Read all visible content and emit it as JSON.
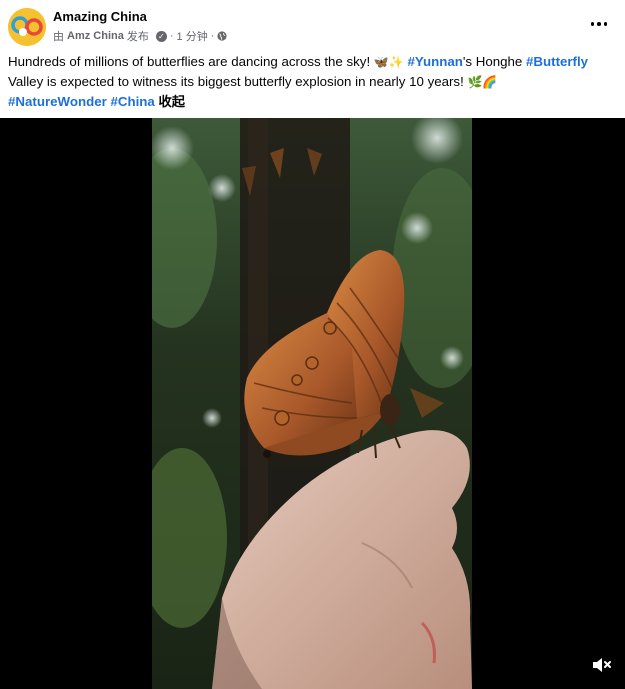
{
  "header": {
    "page_name": "Amazing China",
    "author_prefix": "由",
    "author": "Amz China",
    "published": "发布",
    "separator": "·",
    "time_ago": "1 分钟",
    "separator2": "·",
    "more_icon": "more-horizontal-icon",
    "verified_icon": "verified-badge-icon",
    "audience_icon": "globe-icon"
  },
  "caption": {
    "part1": "Hundreds of millions of butterflies are dancing across the sky! ",
    "emoji1": "🦋✨",
    "space1": " ",
    "tag_yunnan": "#Yunnan",
    "part2": "'s Honghe ",
    "tag_butterfly": "#Butterfly",
    "part3": " Valley is expected to witness its biggest butterfly explosion in nearly 10 years! ",
    "emoji2": "🌿🌈",
    "space2": " ",
    "tag_nature": "#NatureWonder",
    "space3": " ",
    "tag_china": "#China",
    "space4": " ",
    "collapse": "收起"
  },
  "video": {
    "mute_icon": "speaker-muted-icon"
  },
  "colors": {
    "link": "#1d6fd8",
    "text": "#050505",
    "secondary": "#65676b",
    "avatar_bg": "#f6c12f"
  }
}
